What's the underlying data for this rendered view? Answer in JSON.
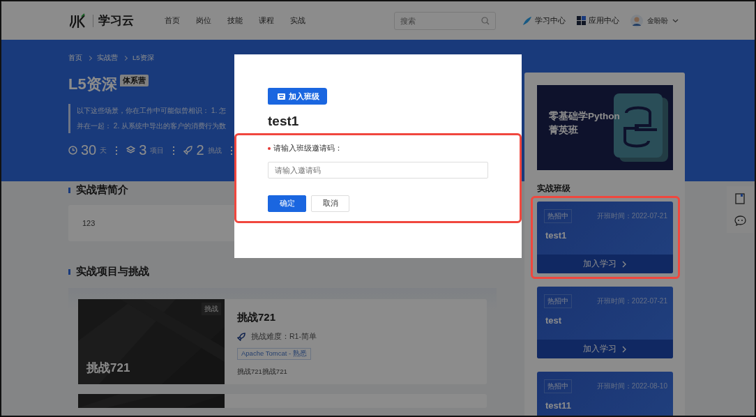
{
  "header": {
    "logo_text": "学习云",
    "nav": [
      {
        "label": "首页",
        "selected": false
      },
      {
        "label": "岗位",
        "selected": false
      },
      {
        "label": "技能",
        "selected": false
      },
      {
        "label": "课程",
        "selected": false
      },
      {
        "label": "实战",
        "selected": false
      }
    ],
    "search": {
      "placeholder": "搜索"
    },
    "links": [
      {
        "kind": "learning",
        "label": "学习中心"
      },
      {
        "kind": "apps",
        "label": "应用中心"
      }
    ],
    "user": "金盼盼"
  },
  "banner": {
    "breadcrumb": [
      "首页",
      "实战营",
      "L5资深"
    ],
    "title": "L5资深",
    "badge": "体系营",
    "description": [
      "以下这些场景，你在工作中可能似曾相识： 1. 怎",
      "并在一起： 2. 从系统中导出的客户的消费行为数"
    ],
    "stats": [
      {
        "kind": "days",
        "value": "30",
        "unit": "天"
      },
      {
        "kind": "projects",
        "value": "3",
        "unit": "项目"
      },
      {
        "kind": "challenges",
        "value": "2",
        "unit": "挑战"
      }
    ]
  },
  "intro": {
    "heading": "实战营简介",
    "text": "123"
  },
  "projects": {
    "heading": "实战项目与挑战",
    "items": [
      {
        "kind": "full",
        "cover_title": "挑战721",
        "tag": "挑战",
        "title": "挑战721",
        "difficulty": "挑战难度：R1-简单",
        "skill": "Apache Tomcat - 熟悉",
        "description": "挑战721挑战721"
      },
      {
        "kind": "partial"
      }
    ]
  },
  "sidebar": {
    "cover": [
      "零基础学Python",
      "菁英班"
    ],
    "heading": "实战班级",
    "classes": [
      {
        "status": "热招中",
        "start": "开班时间：2022-07-21",
        "name": "test1",
        "action": "加入学习",
        "highlighted": true
      },
      {
        "status": "热招中",
        "start": "开班时间：2022-07-21",
        "name": "test",
        "action": "加入学习",
        "highlighted": false
      },
      {
        "status": "热招中",
        "start": "开班时间：2022-08-10",
        "name": "test11",
        "highlighted": false
      }
    ]
  },
  "modal": {
    "tag": "加入班级",
    "title": "test1",
    "label": "请输入班级邀请码：",
    "required": true,
    "placeholder": "请输入邀请码",
    "highlighted": true,
    "buttons": [
      {
        "kind": "primary",
        "label": "确定"
      },
      {
        "kind": "default",
        "label": "取消"
      }
    ]
  }
}
